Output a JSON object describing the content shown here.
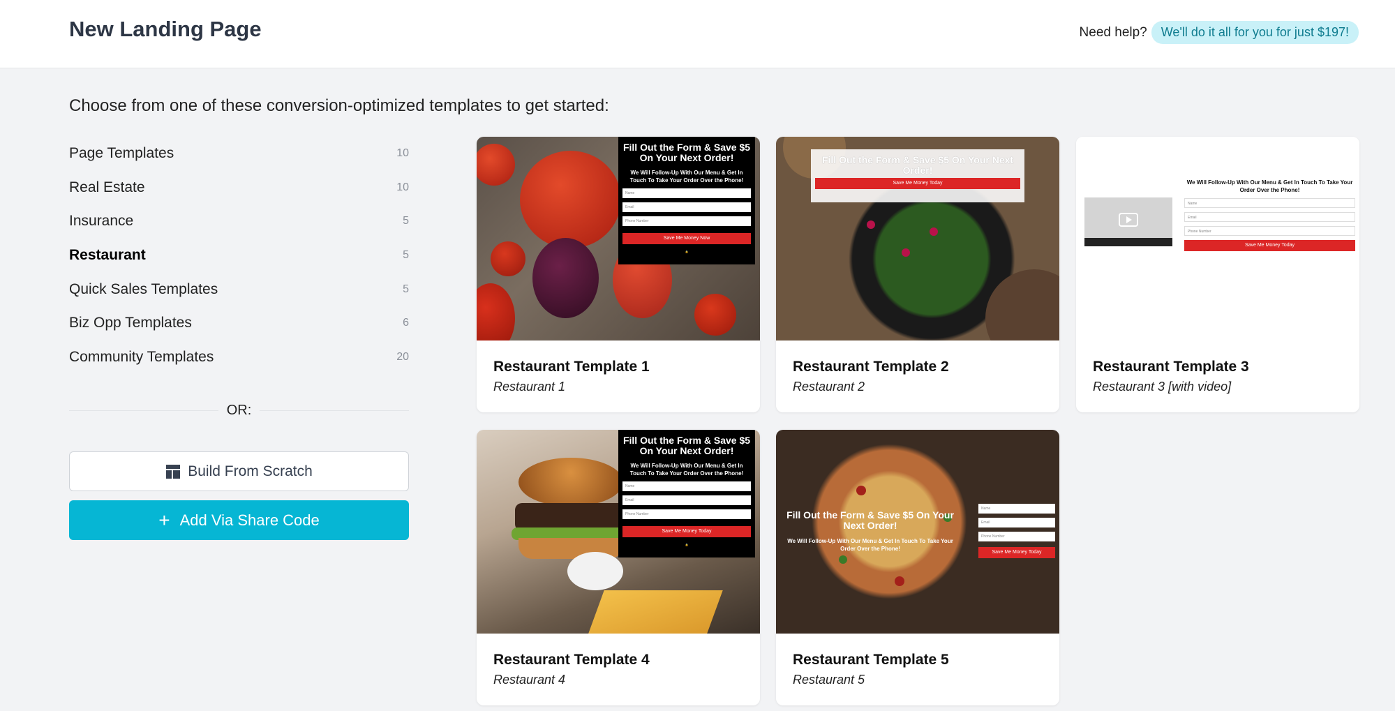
{
  "header": {
    "title": "New Landing Page",
    "help_label": "Need help?",
    "help_offer": "We'll do it all for you for just $197!"
  },
  "intro": "Choose from one of these conversion-optimized templates to get started:",
  "categories": [
    {
      "label": "Page Templates",
      "count": "10"
    },
    {
      "label": "Real Estate",
      "count": "10"
    },
    {
      "label": "Insurance",
      "count": "5"
    },
    {
      "label": "Restaurant",
      "count": "5",
      "active": true
    },
    {
      "label": "Quick Sales Templates",
      "count": "5"
    },
    {
      "label": "Biz Opp Templates",
      "count": "6"
    },
    {
      "label": "Community Templates",
      "count": "20"
    }
  ],
  "or_label": "OR:",
  "buttons": {
    "build_from_scratch": "Build From Scratch",
    "add_via_share_code": "Add Via Share Code"
  },
  "templates": [
    {
      "title": "Restaurant Template 1",
      "subtitle": "Restaurant 1",
      "preview": {
        "headline": "Fill Out the Form & Save $5 On Your Next Order!",
        "sub": "We Will Follow-Up With Our Menu & Get In Touch To Take Your Order Over the Phone!",
        "fields": [
          "Name",
          "Email",
          "Phone Number"
        ],
        "button": "Save Me Money Now"
      }
    },
    {
      "title": "Restaurant Template 2",
      "subtitle": "Restaurant 2",
      "preview": {
        "headline": "Fill Out the Form & Save $5 On Your Next Order!",
        "button": "Save Me Money Today"
      }
    },
    {
      "title": "Restaurant Template 3",
      "subtitle": "Restaurant 3 [with video]",
      "preview": {
        "headline": "We Will Follow-Up With Our Menu & Get In Touch To Take Your Order Over the Phone!",
        "fields": [
          "Name",
          "Email",
          "Phone Number"
        ],
        "button": "Save Me Money Today"
      }
    },
    {
      "title": "Restaurant Template 4",
      "subtitle": "Restaurant 4",
      "preview": {
        "headline": "Fill Out the Form & Save $5 On Your Next Order!",
        "sub": "We Will Follow-Up With Our Menu & Get In Touch To Take Your Order Over the Phone!",
        "fields": [
          "Name",
          "Email",
          "Phone Number"
        ],
        "button": "Save Me Money Today"
      }
    },
    {
      "title": "Restaurant Template 5",
      "subtitle": "Restaurant 5",
      "preview": {
        "headline": "Fill Out the Form & Save $5 On Your Next Order!",
        "sub": "We Will Follow-Up With Our Menu & Get In Touch To Take Your Order Over the Phone!",
        "fields": [
          "Name",
          "Email",
          "Phone Number"
        ],
        "button": "Save Me Money Today"
      }
    }
  ],
  "colors": {
    "accent": "#06b6d4",
    "help_pill_bg": "#c9f1f8",
    "cta_red": "#dc2626"
  }
}
